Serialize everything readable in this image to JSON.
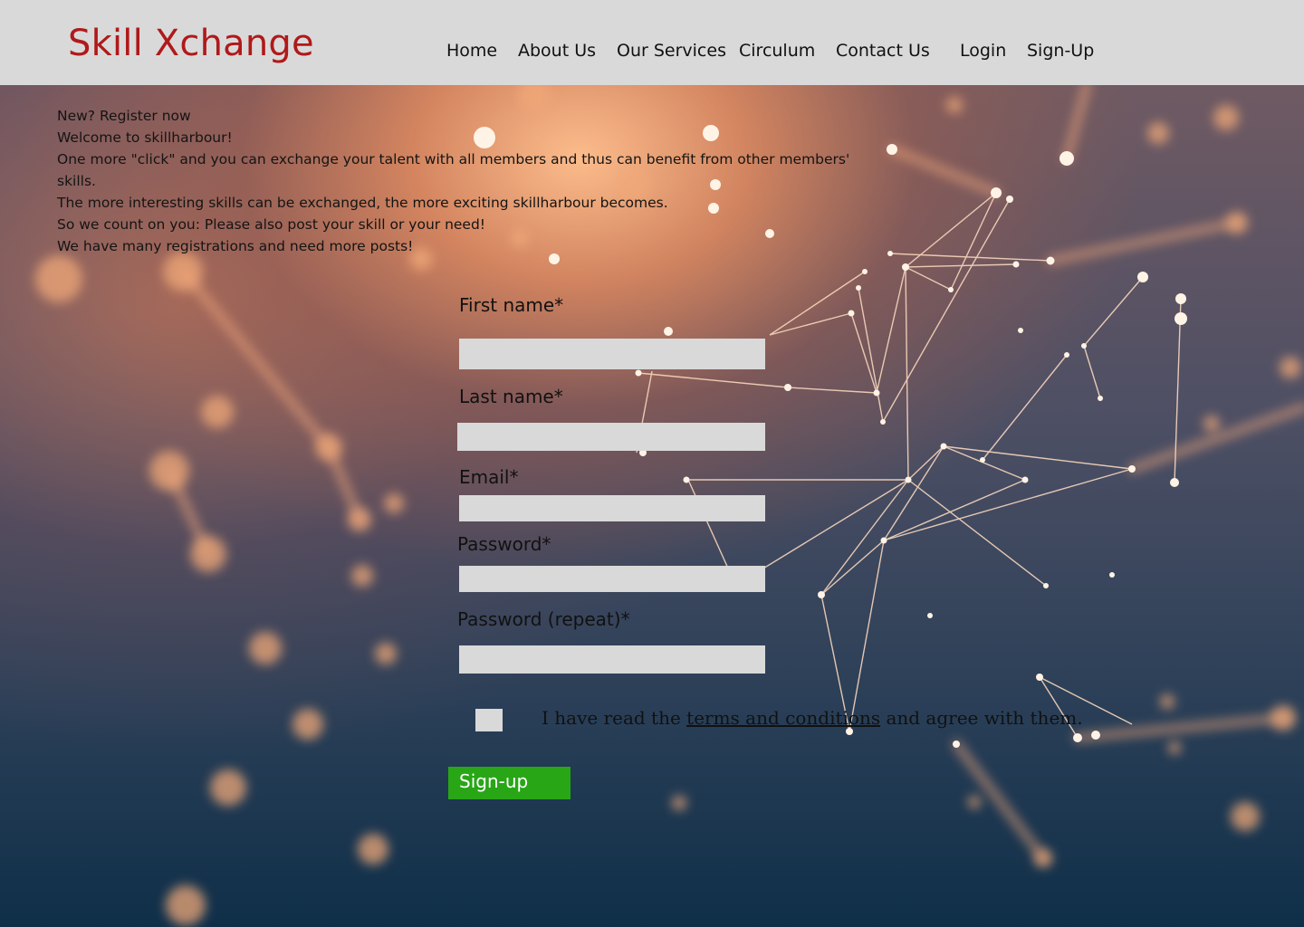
{
  "header": {
    "logo": "Skill Xchange",
    "nav": {
      "home": "Home",
      "about": "About Us",
      "services": "Our Services",
      "circulum": "Circulum",
      "contact": "Contact Us",
      "login": "Login",
      "signup": "Sign-Up"
    }
  },
  "intro": {
    "line1": "New? Register now",
    "line2": "Welcome to skillharbour!",
    "line3": "One more \"click\" and you can exchange your talent with all members and thus can benefit from other members'",
    "line4": "skills.",
    "line5": "The more interesting skills can be exchanged, the more exciting skillharbour becomes.",
    "line6": "So we count on you: Please also post your skill or your need!",
    "line7": "We have many registrations and need more posts!"
  },
  "form": {
    "first_name_label": "First name*",
    "last_name_label": "Last name*",
    "email_label": "Email*",
    "password_label": "Password*",
    "password_repeat_label": "Password (repeat)*",
    "agree_before": "I have read the ",
    "agree_link": "terms and conditions",
    "agree_after": " and agree with them.",
    "submit_label": "Sign-up"
  },
  "colors": {
    "header_bg": "#d9d9d9",
    "logo": "#b0191a",
    "submit_bg": "#28a616",
    "input_bg": "#d9d9d9"
  },
  "background": "network-of-glowing-orange-nodes-image"
}
